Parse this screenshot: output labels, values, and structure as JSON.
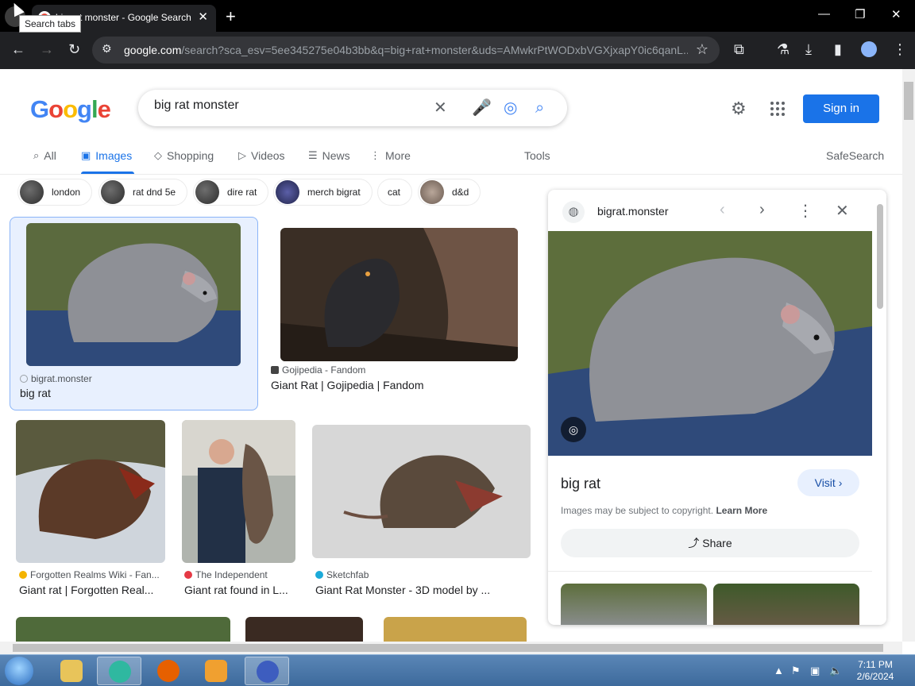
{
  "browser": {
    "tab_title": "big rat monster - Google Search",
    "tooltip": "Search tabs",
    "url_host": "google.com",
    "url_path": "/search?sca_esv=5ee345275e04b3bb&q=big+rat+monster&uds=AMwkrPtWODxbVGXjxapY0ic6qanL..."
  },
  "header": {
    "logo": [
      "G",
      "o",
      "o",
      "g",
      "l",
      "e"
    ],
    "query": "big rat monster",
    "signin": "Sign in"
  },
  "nav": {
    "all": "All",
    "images": "Images",
    "shopping": "Shopping",
    "videos": "Videos",
    "news": "News",
    "more": "More",
    "tools": "Tools",
    "safesearch": "SafeSearch"
  },
  "chips": [
    "london",
    "rat dnd 5e",
    "dire rat",
    "merch bigrat",
    "cat",
    "d&d"
  ],
  "results": [
    {
      "source": "bigrat.monster",
      "title": "big rat"
    },
    {
      "source": "Gojipedia - Fandom",
      "title": "Giant Rat | Gojipedia | Fandom"
    },
    {
      "source": "Forgotten Realms Wiki - Fan...",
      "title": "Giant rat | Forgotten Real..."
    },
    {
      "source": "The Independent",
      "title": "Giant rat found in L..."
    },
    {
      "source": "Sketchfab",
      "title": "Giant Rat Monster - 3D model by ..."
    }
  ],
  "panel": {
    "site": "bigrat.monster",
    "title": "big rat",
    "visit": "Visit",
    "copyright": "Images may be subject to copyright.",
    "learn_more": "Learn More",
    "share": "Share"
  },
  "taskbar": {
    "time": "7:11 PM",
    "date": "2/6/2024"
  },
  "colors": {
    "accent": "#1a73e8",
    "chrome_dark": "#202124"
  }
}
